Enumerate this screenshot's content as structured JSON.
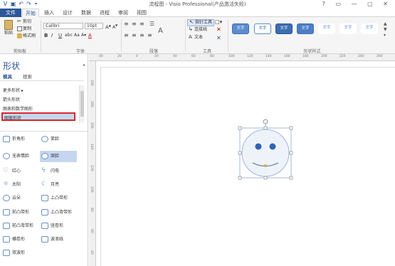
{
  "window": {
    "title": "流程图 - Visio Professional(产品激活失败)"
  },
  "tabs": [
    "文件",
    "开始",
    "插入",
    "设计",
    "数据",
    "进程",
    "审阅",
    "视图"
  ],
  "ribbon": {
    "clipboard": {
      "paste": "粘贴",
      "cut": "剪切",
      "copy": "复制",
      "format_painter": "格式刷",
      "label": "剪贴板"
    },
    "font": {
      "family": "Calibri",
      "size": "10pt",
      "label": "字体"
    },
    "paragraph": {
      "label": "段落"
    },
    "tools": {
      "pointer": "指针工具",
      "connector": "连接线",
      "text": "文本",
      "label": "工具"
    },
    "shape_styles": {
      "label": "形状样式",
      "swatch_text": "文字"
    }
  },
  "shapes_pane": {
    "title": "形状",
    "tabs": [
      "模具",
      "搜索"
    ],
    "more_shapes": "更多形状",
    "stencils": [
      "箭头形状",
      "图表和数学图形",
      "图案形状"
    ],
    "items": [
      [
        "折角形",
        "笑脸"
      ],
      [
        "无表情脸",
        "哭脸"
      ],
      [
        "红心",
        "闪电"
      ],
      [
        "太阳",
        "月亮"
      ],
      [
        "云朵",
        "上凸带形"
      ],
      [
        "前凸带形",
        "上凸弯带形"
      ],
      [
        "前凸弯带形",
        "竖卷形"
      ],
      [
        "横卷形",
        "波浪线"
      ],
      [
        "双波形",
        ""
      ]
    ]
  },
  "ruler_top": [
    "40",
    "20",
    "0",
    "20",
    "40",
    "60",
    "80",
    "100",
    "120",
    "140",
    "160",
    "180",
    "200",
    "220",
    "240",
    "260"
  ],
  "ruler_left": [
    "200",
    "180",
    "160",
    "140",
    "120",
    "100",
    "80",
    "60",
    "40"
  ],
  "colors": {
    "accent": "#2b579a",
    "file_tab": "#2b579a",
    "selection": "#c5d7f0"
  }
}
